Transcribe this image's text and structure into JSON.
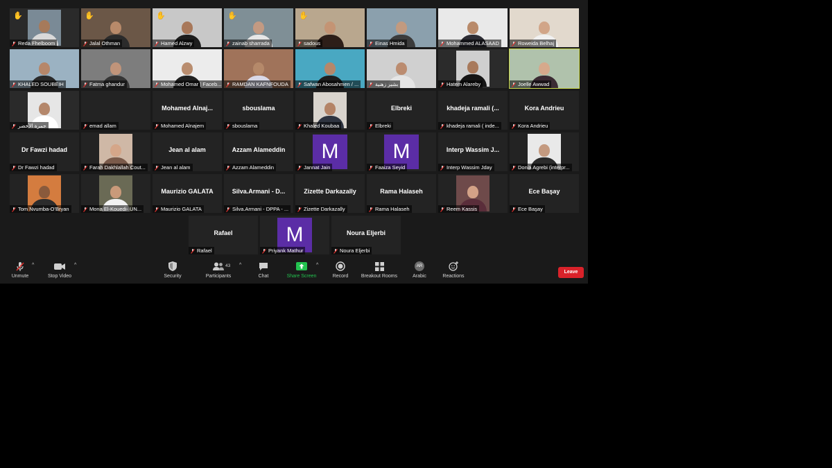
{
  "participants": [
    {
      "name": "Reda Fhelboom",
      "label": "Reda Fhelboom",
      "kind": "video",
      "hand": true,
      "bg": "#2a2a2a",
      "photo": "#7a8a96",
      "skin": "#a67a5b",
      "shirt": "#d9d9d9",
      "small": true
    },
    {
      "name": "Jalal Othman",
      "label": "Jalal Othman",
      "kind": "video",
      "hand": true,
      "bg": "#3b2e26",
      "photo": "#6b5747",
      "skin": "#b88a6a",
      "shirt": "#2b2b2b"
    },
    {
      "name": "Hamed Alzwy",
      "label": "Hamed Alzwy",
      "kind": "video",
      "hand": true,
      "bg": "#9b9b9b",
      "photo": "#c8c8c8",
      "skin": "#a8785a",
      "shirt": "#1d1d1d"
    },
    {
      "name": "zainab sharrada",
      "label": "zainab sharrada",
      "kind": "video",
      "hand": true,
      "bg": "#4a4a4a",
      "photo": "#7f8f96",
      "skin": "#c39a82",
      "shirt": "#e6e6e6"
    },
    {
      "name": "sadous",
      "label": "sadous",
      "kind": "video",
      "hand": true,
      "bg": "#8a7a66",
      "photo": "#b9a78e",
      "skin": "#c49474",
      "shirt": "#2d1e18"
    },
    {
      "name": "Einas Hmida",
      "label": "Einas Hmida",
      "kind": "video",
      "hand": false,
      "bg": "#5e6e79",
      "photo": "#8ba0ad",
      "skin": "#c29a7f",
      "shirt": "#3b3b3b"
    },
    {
      "name": "Mohammed ALASAAD",
      "label": "Mohammed ALASAAD",
      "kind": "video",
      "hand": false,
      "bg": "#d8d8d8",
      "photo": "#e9e9e9",
      "skin": "#b88a6a",
      "shirt": "#2c2c34"
    },
    {
      "name": "Roweida Belhaj",
      "label": "Roweida Belhaj",
      "kind": "video",
      "hand": false,
      "bg": "#c9c1b6",
      "photo": "#e2d9cd",
      "skin": "#d1a588",
      "shirt": "#f0f0f0"
    },
    {
      "name": "KHALED SOUBEIH",
      "label": "KHALED SOUBEIH",
      "kind": "video",
      "hand": false,
      "bg": "#6a7f8e",
      "photo": "#9bb2c2",
      "skin": "#b6876a",
      "shirt": "#2a2a2a"
    },
    {
      "name": "Fatma ghandur",
      "label": "Fatma ghandur",
      "kind": "video",
      "hand": false,
      "bg": "#5b5b5b",
      "photo": "#7d7d7d",
      "skin": "#c0947a",
      "shirt": "#353535"
    },
    {
      "name": "Mohamed Omar | Faceb...",
      "label": "Mohamed Omar | Faceb...",
      "kind": "video",
      "hand": false,
      "bg": "#cfcfcf",
      "photo": "#ececec",
      "skin": "#b98d6f",
      "shirt": "#202020"
    },
    {
      "name": "RAMDAN KAFNFOUDA",
      "label": "RAMDAN KAFNFOUDA",
      "kind": "video",
      "hand": false,
      "bg": "#6e4f3e",
      "photo": "#a0735a",
      "skin": "#b5896a",
      "shirt": "#d9d9e8"
    },
    {
      "name": "Safwan Abosahmen / ...",
      "label": "Safwan Abosahmen / ...",
      "kind": "video",
      "hand": false,
      "bg": "#2f7a8f",
      "photo": "#49a8c2",
      "skin": "#b5876a",
      "shirt": "#1e1e1e"
    },
    {
      "name": "بشير زهنية",
      "label": "بشير زهنية",
      "kind": "video",
      "hand": false,
      "bg": "#a9a9a9",
      "photo": "#d0d0d0",
      "skin": "#bb8c70",
      "shirt": "#e5e5e5"
    },
    {
      "name": "Hatem Alareby",
      "label": "Hatem Alareby",
      "kind": "video",
      "hand": false,
      "bg": "#2b2b2b",
      "photo": "#cfcfcf",
      "skin": "#a87a5c",
      "shirt": "#151515",
      "small": true
    },
    {
      "name": "Joelle Awwad",
      "label": "Joelle Awwad",
      "kind": "video",
      "hand": false,
      "bg": "#8b9d88",
      "photo": "#b0c2ac",
      "skin": "#d6a98c",
      "shirt": "#3b2b33",
      "active": true
    },
    {
      "name": "جمرة الأخضر",
      "label": "جمرة الأخضر",
      "kind": "video",
      "hand": false,
      "bg": "#2a2a2a",
      "photo": "#e6e6e6",
      "skin": "#b4876b",
      "shirt": "#ffffff",
      "small": true
    },
    {
      "name": "emad allam",
      "label": "emad allam",
      "kind": "name",
      "text": "",
      "hand": false
    },
    {
      "name": "Mohamed Alnajem",
      "label": "Mohamed Alnajem",
      "kind": "name",
      "text": "Mohamed  Alnaj...",
      "hand": false
    },
    {
      "name": "sbouslama",
      "label": "sbouslama",
      "kind": "name",
      "text": "sbouslama",
      "hand": false
    },
    {
      "name": "Khaled Koubaa",
      "label": "Khaled Koubaa",
      "kind": "video",
      "hand": false,
      "bg": "#232323",
      "photo": "#d9d4cd",
      "skin": "#b48467",
      "shirt": "#2e3440",
      "small": true
    },
    {
      "name": "Elbreki",
      "label": "Elbreki",
      "kind": "name",
      "text": "Elbreki",
      "hand": false
    },
    {
      "name": "khadeja ramali",
      "label": "khadeja ramali ( inde...",
      "kind": "name",
      "text": "khadeja  ramali  (...",
      "hand": false
    },
    {
      "name": "Kora Andrieu",
      "label": "Kora Andrieu",
      "kind": "name",
      "text": "Kora Andrieu",
      "hand": false
    },
    {
      "name": "Dr Fawzi hadad",
      "label": "Dr Fawzi hadad",
      "kind": "name",
      "text": "Dr Fawzi hadad",
      "hand": false
    },
    {
      "name": "Farah Dakhlallah",
      "label": "Farah Dakhlallah Cout...",
      "kind": "video",
      "hand": false,
      "bg": "#232323",
      "photo": "#cfb8a6",
      "skin": "#d5a689",
      "shirt": "#7a5a4a",
      "small": true
    },
    {
      "name": "Jean al alam",
      "label": "Jean al alam",
      "kind": "name",
      "text": "Jean al alam",
      "hand": false
    },
    {
      "name": "Azzam Alameddin",
      "label": "Azzam Alameddin",
      "kind": "name",
      "text": "Azzam Alameddin",
      "hand": false
    },
    {
      "name": "Jannat Jain",
      "label": "Jannat Jain",
      "kind": "avatar",
      "text": "M",
      "hand": false
    },
    {
      "name": "Faaiza Seyid",
      "label": "Faaiza Seyid",
      "kind": "avatar",
      "text": "M",
      "hand": false
    },
    {
      "name": "Interp Wassim Jday",
      "label": "Interp Wassim Jday",
      "kind": "name",
      "text": "Interp  Wassim  J...",
      "hand": false
    },
    {
      "name": "Donia Agrebi",
      "label": "Donia Agrebi (interpr...",
      "kind": "video",
      "hand": false,
      "bg": "#232323",
      "photo": "#e9e9e9",
      "skin": "#c49a80",
      "shirt": "#2b2b2b",
      "small": true
    },
    {
      "name": "Tom Nvumba-O'Bryan",
      "label": "Tom Nvumba-O'Bryan",
      "kind": "video",
      "hand": false,
      "bg": "#232323",
      "photo": "#d47c3f",
      "skin": "#8a5a3c",
      "shirt": "#2c2c2c",
      "small": true
    },
    {
      "name": "Mona El-Kouedi",
      "label": "Mona El-Kouedi- UN...",
      "kind": "video",
      "hand": false,
      "bg": "#232323",
      "photo": "#6a6a55",
      "skin": "#c99a7a",
      "shirt": "#f2f2f2",
      "small": true
    },
    {
      "name": "Maurizio GALATA",
      "label": "Maurizio GALATA",
      "kind": "name",
      "text": "Maurizio GALATA",
      "hand": false
    },
    {
      "name": "Silva.Armani - DPPA",
      "label": "Silva.Armani - DPPA - ...",
      "kind": "name",
      "text": "Silva.Armani  -  D...",
      "hand": false
    },
    {
      "name": "Zizette Darkazally",
      "label": "Zizette Darkazally",
      "kind": "name",
      "text": "Zizette Darkazally",
      "hand": false
    },
    {
      "name": "Rama Halaseh",
      "label": "Rama Halaseh",
      "kind": "name",
      "text": "Rama Halaseh",
      "hand": false
    },
    {
      "name": "Reem Kassis",
      "label": "Reem Kassis",
      "kind": "video",
      "hand": false,
      "bg": "#232323",
      "photo": "#6e4a4a",
      "skin": "#d3a287",
      "shirt": "#5a2d3a",
      "small": true
    },
    {
      "name": "Ece Başay",
      "label": "Ece Başay",
      "kind": "name",
      "text": "Ece Başay",
      "hand": false
    },
    {
      "name": "Rafael",
      "label": "Rafael",
      "kind": "name",
      "text": "Rafael",
      "hand": false
    },
    {
      "name": "Priyank Mathur",
      "label": "Priyank Mathur",
      "kind": "avatar",
      "text": "M",
      "hand": false
    },
    {
      "name": "Noura Eljerbi",
      "label": "Noura Eljerbi",
      "kind": "name",
      "text": "Noura Eljerbi",
      "hand": false
    }
  ],
  "toolbar": {
    "unmute": "Unmute",
    "stop_video": "Stop Video",
    "security": "Security",
    "participants": "Participants",
    "participants_count": "43",
    "chat": "Chat",
    "share_screen": "Share Screen",
    "record": "Record",
    "breakout_rooms": "Breakout Rooms",
    "language": "Arabic",
    "language_badge": "AR",
    "reactions": "Reactions",
    "leave": "Leave"
  },
  "colors": {
    "share_green": "#23c24f",
    "leave_red": "#d9222a",
    "avatar_purple": "#5b2da6",
    "active_speaker": "#c9d84a"
  }
}
